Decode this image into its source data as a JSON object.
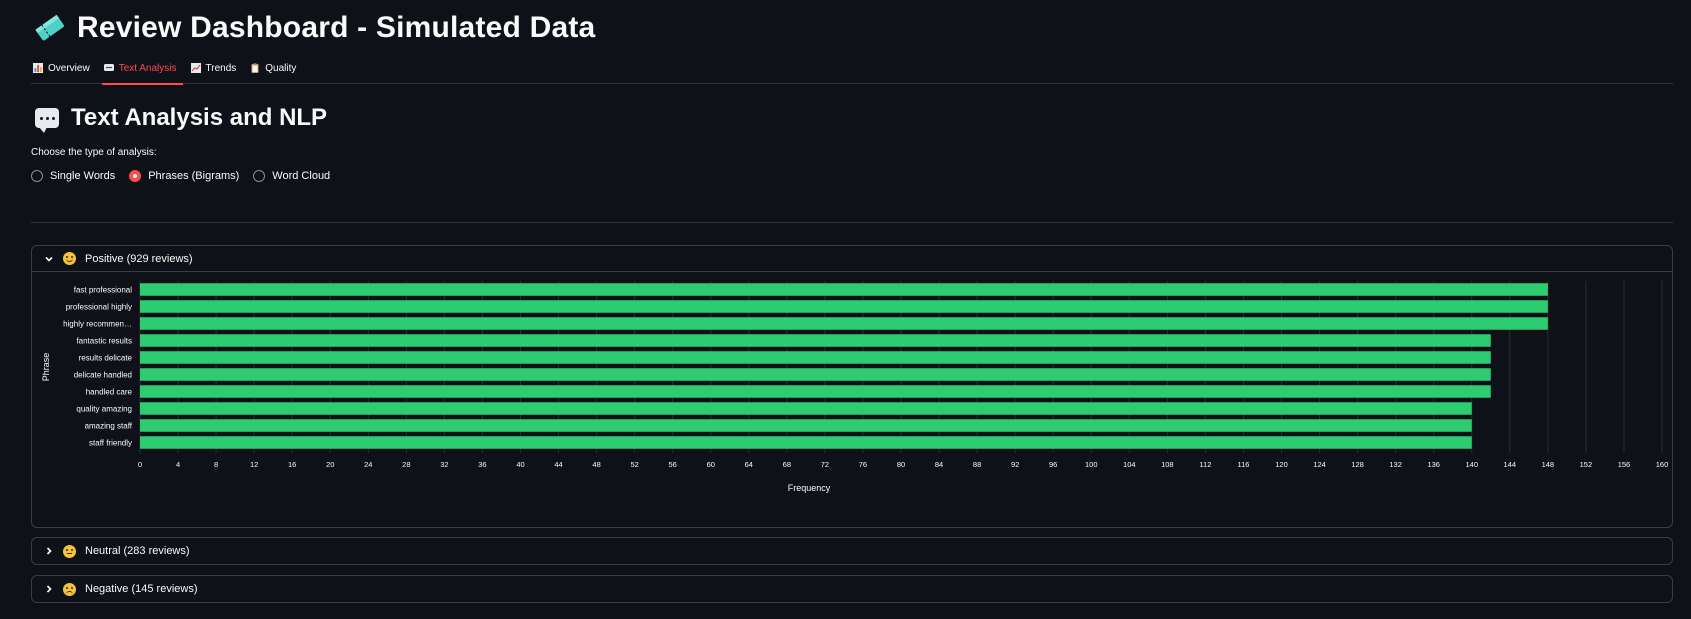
{
  "app": {
    "title": "Review Dashboard - Simulated Data",
    "title_icon": "ticket-icon"
  },
  "tabs": [
    {
      "label": "Overview",
      "icon": "bar-chart-icon",
      "active": false
    },
    {
      "label": "Text Analysis",
      "icon": "speech-bubble-icon",
      "active": true
    },
    {
      "label": "Trends",
      "icon": "trend-chart-icon",
      "active": false
    },
    {
      "label": "Quality",
      "icon": "clipboard-icon",
      "active": false
    }
  ],
  "section": {
    "title": "Text Analysis and NLP",
    "radio_label": "Choose the type of analysis:",
    "options": [
      {
        "label": "Single Words",
        "selected": false
      },
      {
        "label": "Phrases (Bigrams)",
        "selected": true
      },
      {
        "label": "Word Cloud",
        "selected": false
      }
    ]
  },
  "expanders": {
    "positive": {
      "label": "Positive (929 reviews)",
      "expanded": true
    },
    "neutral": {
      "label": "Neutral (283 reviews)",
      "expanded": false
    },
    "negative": {
      "label": "Negative (145 reviews)",
      "expanded": false
    }
  },
  "colors": {
    "accent": "#ff4b4b",
    "bar": "#2ecc71",
    "background": "#0e1117"
  },
  "chart_data": {
    "type": "bar",
    "orientation": "horizontal",
    "categories": [
      "fast professional",
      "professional highly",
      "highly recommen…",
      "fantastic results",
      "results delicate",
      "delicate handled",
      "handled care",
      "quality amazing",
      "amazing staff",
      "staff friendly"
    ],
    "values": [
      148,
      148,
      148,
      142,
      142,
      142,
      142,
      140,
      140,
      140
    ],
    "xlabel": "Frequency",
    "ylabel": "Phrase",
    "xlim": [
      0,
      160
    ],
    "xticks": [
      0,
      4,
      8,
      12,
      16,
      20,
      24,
      28,
      32,
      36,
      40,
      44,
      48,
      52,
      56,
      60,
      64,
      68,
      72,
      76,
      80,
      84,
      88,
      92,
      96,
      100,
      104,
      108,
      112,
      116,
      120,
      124,
      128,
      132,
      136,
      140,
      144,
      148,
      152,
      156,
      160
    ],
    "grid": true
  }
}
